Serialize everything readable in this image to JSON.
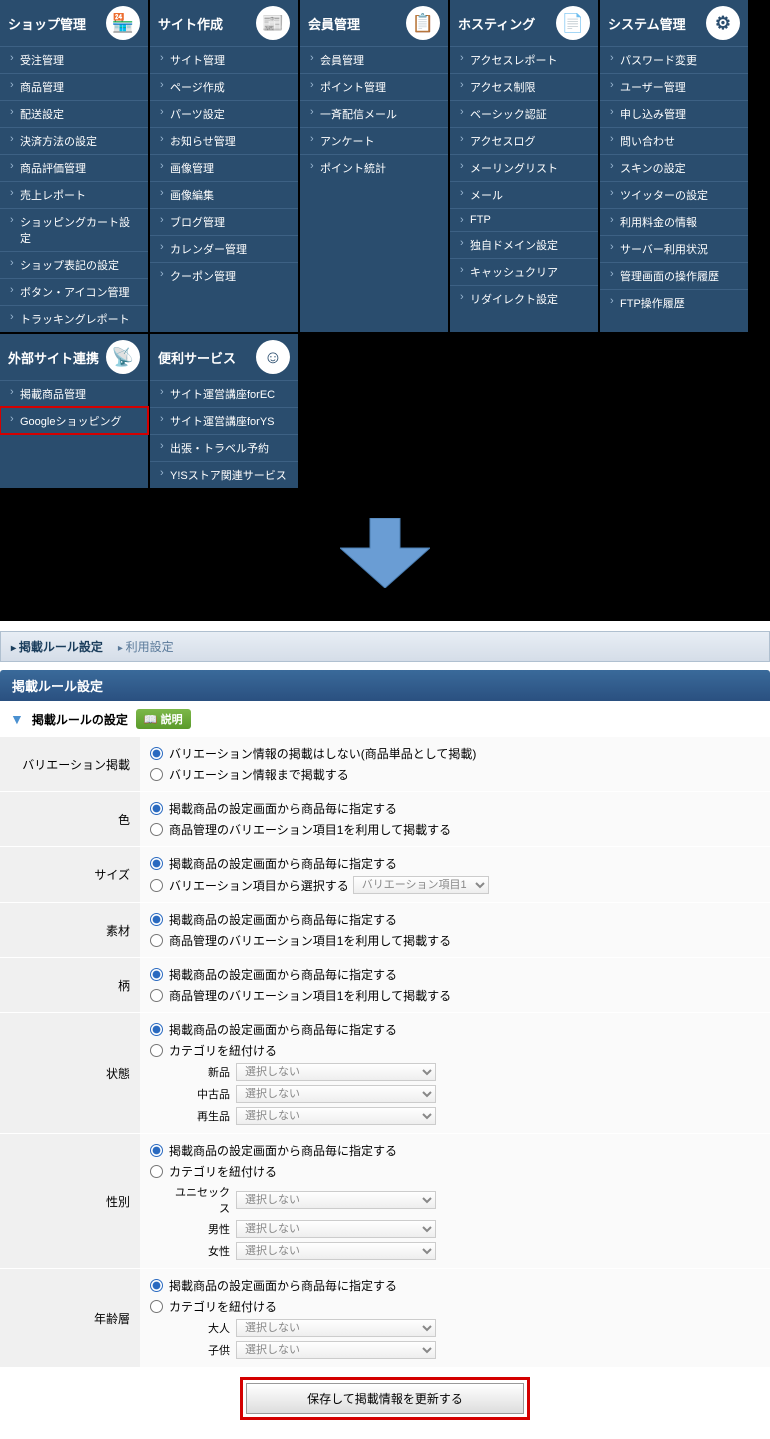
{
  "menus": [
    {
      "title": "ショップ管理",
      "icon": "🏪",
      "items": [
        "受注管理",
        "商品管理",
        "配送設定",
        "決済方法の設定",
        "商品評価管理",
        "売上レポート",
        "ショッピングカート設定",
        "ショップ表記の設定",
        "ボタン・アイコン管理",
        "トラッキングレポート"
      ],
      "highlight": -1
    },
    {
      "title": "サイト作成",
      "icon": "📰",
      "items": [
        "サイト管理",
        "ページ作成",
        "パーツ設定",
        "お知らせ管理",
        "画像管理",
        "画像編集",
        "ブログ管理",
        "カレンダー管理",
        "クーポン管理"
      ],
      "highlight": -1
    },
    {
      "title": "会員管理",
      "icon": "📋",
      "items": [
        "会員管理",
        "ポイント管理",
        "一斉配信メール",
        "アンケート",
        "ポイント統計"
      ],
      "highlight": -1
    },
    {
      "title": "ホスティング",
      "icon": "📄",
      "items": [
        "アクセスレポート",
        "アクセス制限",
        "ベーシック認証",
        "アクセスログ",
        "メーリングリスト",
        "メール",
        "FTP",
        "独自ドメイン設定",
        "キャッシュクリア",
        "リダイレクト設定"
      ],
      "highlight": -1
    },
    {
      "title": "システム管理",
      "icon": "⚙",
      "items": [
        "パスワード変更",
        "ユーザー管理",
        "申し込み管理",
        "問い合わせ",
        "スキンの設定",
        "ツイッターの設定",
        "利用料金の情報",
        "サーバー利用状況",
        "管理画面の操作履歴",
        "FTP操作履歴"
      ],
      "highlight": -1
    },
    {
      "title": "外部サイト連携",
      "icon": "📡",
      "items": [
        "掲載商品管理",
        "Googleショッピング"
      ],
      "highlight": 1
    },
    {
      "title": "便利サービス",
      "icon": "☺",
      "items": [
        "サイト運営講座forEC",
        "サイト運営講座forYS",
        "出張・トラベル予約",
        "Y!Sストア関連サービス"
      ],
      "highlight": -1
    }
  ],
  "tabs": {
    "active": "掲載ルール設定",
    "inactive": "利用設定"
  },
  "section": {
    "title": "掲載ルール設定",
    "sub": "掲載ルールの設定",
    "help": "説明"
  },
  "rows": {
    "variation": {
      "label": "バリエーション掲載",
      "opt1": "バリエーション情報の掲載はしない(商品単品として掲載)",
      "opt2": "バリエーション情報まで掲載する"
    },
    "color": {
      "label": "色",
      "opt1": "掲載商品の設定画面から商品毎に指定する",
      "opt2": "商品管理のバリエーション項目1を利用して掲載する"
    },
    "size": {
      "label": "サイズ",
      "opt1": "掲載商品の設定画面から商品毎に指定する",
      "opt2": "バリエーション項目から選択する",
      "select": "バリエーション項目1"
    },
    "material": {
      "label": "素材",
      "opt1": "掲載商品の設定画面から商品毎に指定する",
      "opt2": "商品管理のバリエーション項目1を利用して掲載する"
    },
    "pattern": {
      "label": "柄",
      "opt1": "掲載商品の設定画面から商品毎に指定する",
      "opt2": "商品管理のバリエーション項目1を利用して掲載する"
    },
    "condition": {
      "label": "状態",
      "opt1": "掲載商品の設定画面から商品毎に指定する",
      "opt2": "カテゴリを紐付ける",
      "subs": [
        {
          "label": "新品",
          "select": "選択しない"
        },
        {
          "label": "中古品",
          "select": "選択しない"
        },
        {
          "label": "再生品",
          "select": "選択しない"
        }
      ]
    },
    "gender": {
      "label": "性別",
      "opt1": "掲載商品の設定画面から商品毎に指定する",
      "opt2": "カテゴリを紐付ける",
      "subs": [
        {
          "label": "ユニセックス",
          "select": "選択しない"
        },
        {
          "label": "男性",
          "select": "選択しない"
        },
        {
          "label": "女性",
          "select": "選択しない"
        }
      ]
    },
    "age": {
      "label": "年齢層",
      "opt1": "掲載商品の設定画面から商品毎に指定する",
      "opt2": "カテゴリを紐付ける",
      "subs": [
        {
          "label": "大人",
          "select": "選択しない"
        },
        {
          "label": "子供",
          "select": "選択しない"
        }
      ]
    }
  },
  "submit": "保存して掲載情報を更新する"
}
